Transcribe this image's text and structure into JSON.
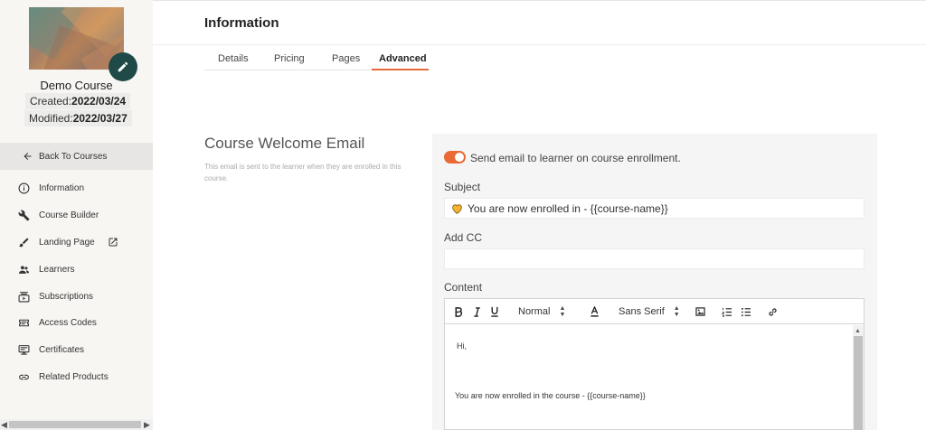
{
  "sidebar": {
    "course_name": "Demo Course",
    "created_label": "Created:",
    "created_value": "2022/03/24",
    "modified_label": "Modified:",
    "modified_value": "2022/03/27",
    "back_label": "Back To Courses",
    "items": [
      {
        "label": "Information",
        "icon": "info-icon"
      },
      {
        "label": "Course Builder",
        "icon": "wrench-icon"
      },
      {
        "label": "Landing Page",
        "icon": "brush-icon"
      },
      {
        "label": "Learners",
        "icon": "people-icon"
      },
      {
        "label": "Subscriptions",
        "icon": "subscriptions-icon"
      },
      {
        "label": "Access Codes",
        "icon": "ticket-icon"
      },
      {
        "label": "Certificates",
        "icon": "monitor-icon"
      },
      {
        "label": "Related Products",
        "icon": "link-icon"
      }
    ]
  },
  "header": {
    "title": "Information"
  },
  "tabs": [
    {
      "label": "Details"
    },
    {
      "label": "Pricing"
    },
    {
      "label": "Pages"
    },
    {
      "label": "Advanced",
      "active": true
    }
  ],
  "welcome": {
    "title": "Course Welcome Email",
    "description": "This email is sent to the learner when they are enrolled in this course.",
    "toggle_label": "Send email to learner on course enrollment.",
    "toggle_on": true,
    "subject_label": "Subject",
    "subject_value": "You are now enrolled in - {{course-name}}",
    "cc_label": "Add CC",
    "cc_value": "",
    "content_label": "Content",
    "toolbar": {
      "header_select": "Normal",
      "font_select": "Sans Serif"
    },
    "body_lines": [
      "Hi,",
      "You are now enrolled in the course - {{course-name}}"
    ]
  },
  "colors": {
    "accent": "#e96a35",
    "edit_button": "#1f4a47",
    "sidebar_bg": "#f8f6f3"
  }
}
